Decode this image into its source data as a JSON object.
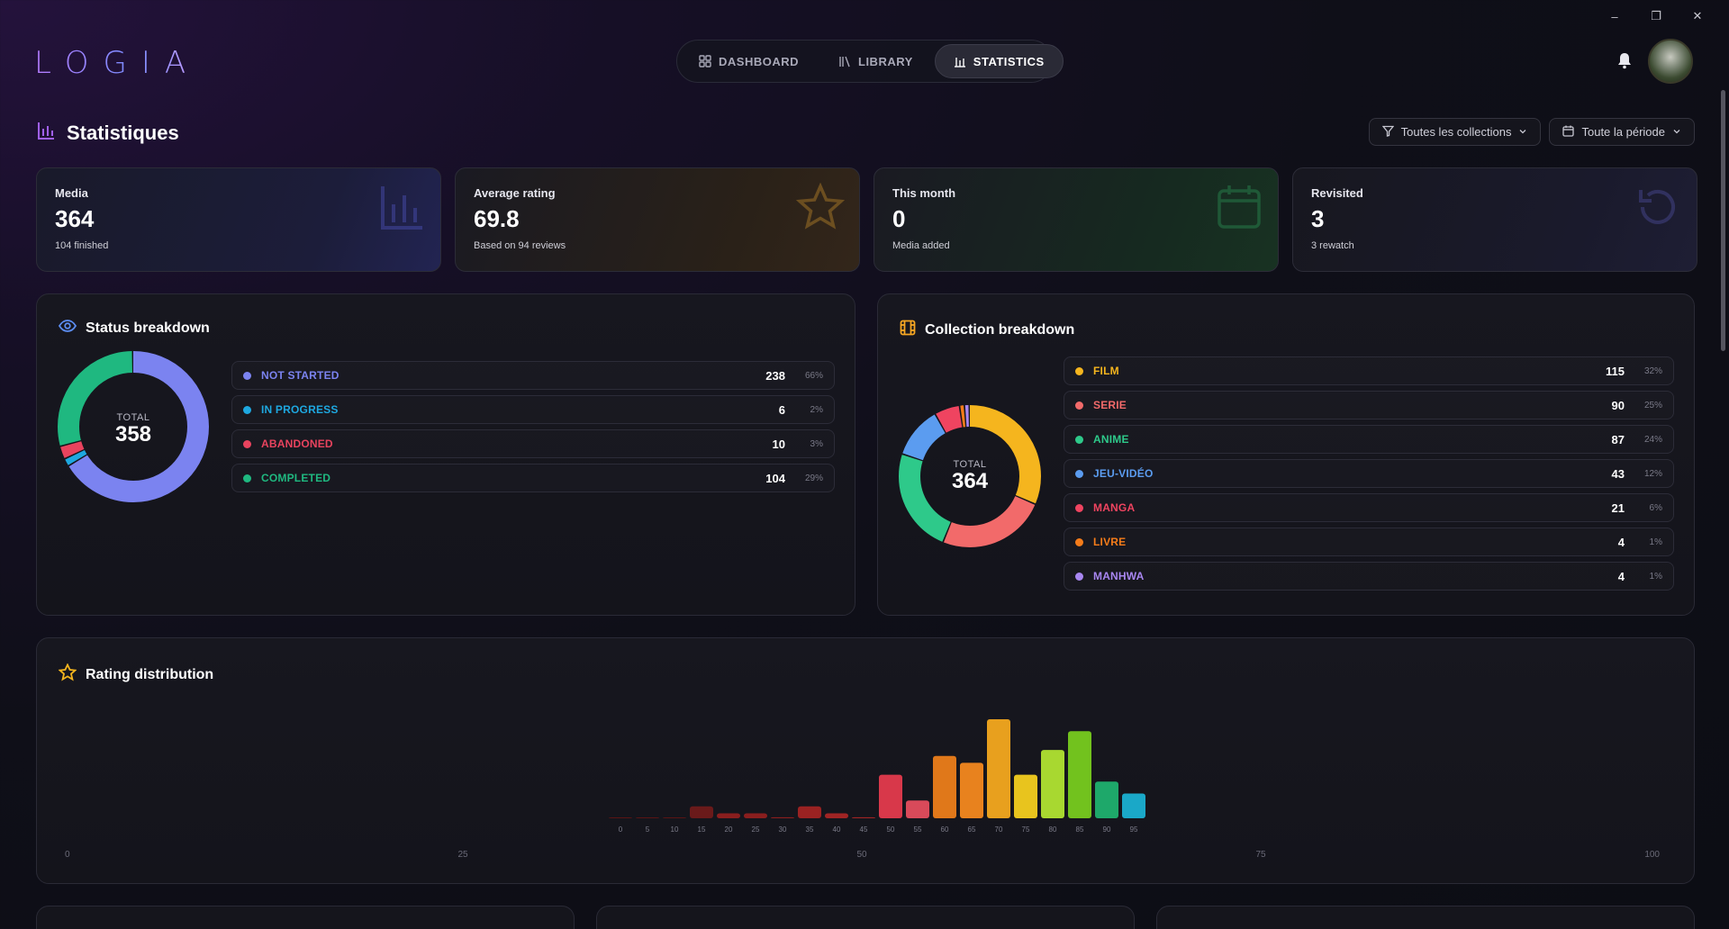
{
  "app": {
    "logo": "LOGIA"
  },
  "window": {
    "minimize": "–",
    "restore": "❐",
    "close": "✕"
  },
  "nav": [
    {
      "label": "DASHBOARD",
      "icon": "dashboard-icon",
      "active": false
    },
    {
      "label": "LIBRARY",
      "icon": "library-icon",
      "active": false
    },
    {
      "label": "STATISTICS",
      "icon": "chart-icon",
      "active": true
    }
  ],
  "page": {
    "title": "Statistiques"
  },
  "filters": {
    "collections": "Toutes les collections",
    "period": "Toute la période"
  },
  "stats": [
    {
      "label": "Media",
      "value": "364",
      "sub": "104 finished",
      "icon": "bar-chart-icon",
      "color": "#5a5fd8"
    },
    {
      "label": "Average rating",
      "value": "69.8",
      "sub": "Based on 94 reviews",
      "icon": "star-icon",
      "color": "#e0a030"
    },
    {
      "label": "This month",
      "value": "0",
      "sub": "Media added",
      "icon": "calendar-icon",
      "color": "#2ea860"
    },
    {
      "label": "Revisited",
      "value": "3",
      "sub": "3 rewatch",
      "icon": "rewind-icon",
      "color": "#6a6ad8"
    }
  ],
  "status": {
    "title": "Status breakdown",
    "total_label": "TOTAL",
    "total": "358",
    "items": [
      {
        "name": "NOT STARTED",
        "count": "238",
        "pct": "66%",
        "color": "#7b83f0"
      },
      {
        "name": "IN PROGRESS",
        "count": "6",
        "pct": "2%",
        "color": "#1ea8e0"
      },
      {
        "name": "ABANDONED",
        "count": "10",
        "pct": "3%",
        "color": "#e8435e"
      },
      {
        "name": "COMPLETED",
        "count": "104",
        "pct": "29%",
        "color": "#1fb880"
      }
    ]
  },
  "collection": {
    "title": "Collection breakdown",
    "total_label": "TOTAL",
    "total": "364",
    "items": [
      {
        "name": "FILM",
        "count": "115",
        "pct": "32%",
        "color": "#f5b51e"
      },
      {
        "name": "SERIE",
        "count": "90",
        "pct": "25%",
        "color": "#f26a6a"
      },
      {
        "name": "ANIME",
        "count": "87",
        "pct": "24%",
        "color": "#2ec98a"
      },
      {
        "name": "JEU-VIDÉO",
        "count": "43",
        "pct": "12%",
        "color": "#5b9cf0"
      },
      {
        "name": "MANGA",
        "count": "21",
        "pct": "6%",
        "color": "#ef4460"
      },
      {
        "name": "LIVRE",
        "count": "4",
        "pct": "1%",
        "color": "#f57c1a"
      },
      {
        "name": "MANHWA",
        "count": "4",
        "pct": "1%",
        "color": "#a886f0"
      }
    ]
  },
  "rating": {
    "title": "Rating distribution",
    "axis": [
      "0",
      "25",
      "50",
      "75",
      "100"
    ]
  },
  "chart_data": {
    "type": "bar",
    "categories": [
      "0",
      "5",
      "10",
      "15",
      "20",
      "25",
      "30",
      "35",
      "40",
      "45",
      "50",
      "55",
      "60",
      "65",
      "70",
      "75",
      "80",
      "85",
      "90",
      "95"
    ],
    "values": [
      0,
      0,
      0,
      1.2,
      0.5,
      0.5,
      0.1,
      1.2,
      0.5,
      0.1,
      4.4,
      1.8,
      6.3,
      5.6,
      10,
      4.4,
      6.9,
      8.8,
      3.7,
      2.5
    ],
    "colors": [
      "#5a1414",
      "#5a1414",
      "#5a1414",
      "#6a1a1a",
      "#8a1e1e",
      "#8a1e1e",
      "#8a1e1e",
      "#9a2222",
      "#a02424",
      "#a02424",
      "#d8384a",
      "#d84a5a",
      "#e0781a",
      "#e8821e",
      "#e8a01e",
      "#e8c41e",
      "#a8d830",
      "#72c21e",
      "#1ea86a",
      "#1aa8c8"
    ],
    "ylim": [
      0,
      10
    ]
  }
}
